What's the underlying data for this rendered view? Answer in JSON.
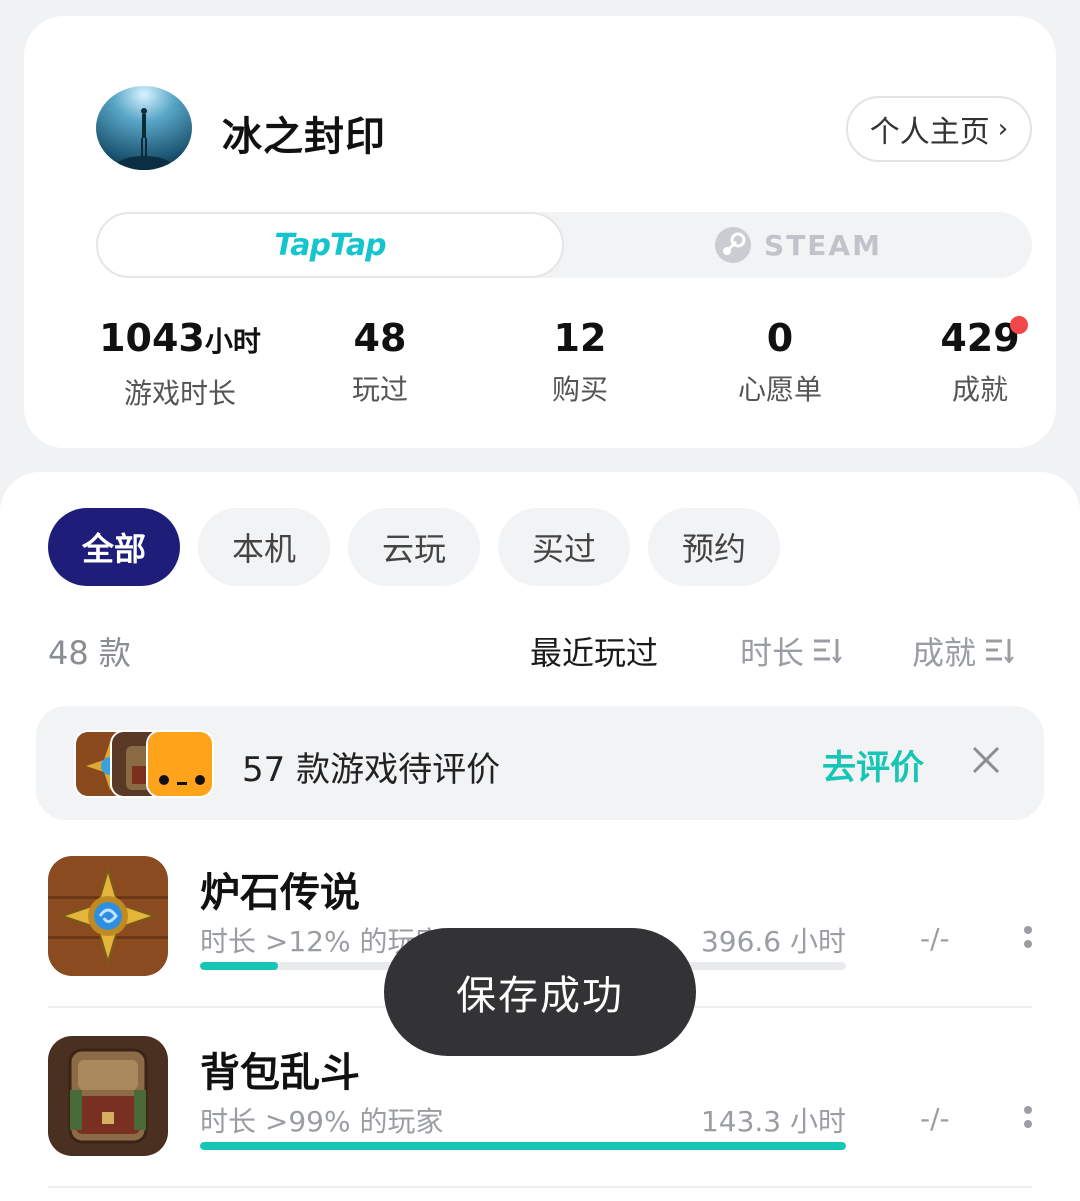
{
  "profile": {
    "username": "冰之封印",
    "homepage_label": "个人主页",
    "platform_tabs": {
      "taptap": "TapTap",
      "steam": "STEAM"
    },
    "stats": [
      {
        "value": "1043",
        "unit": "小时",
        "label": "游戏时长"
      },
      {
        "value": "48",
        "unit": "",
        "label": "玩过"
      },
      {
        "value": "12",
        "unit": "",
        "label": "购买"
      },
      {
        "value": "0",
        "unit": "",
        "label": "心愿单"
      },
      {
        "value": "429",
        "unit": "",
        "label": "成就",
        "badge": "red-dot"
      }
    ]
  },
  "filters": [
    "全部",
    "本机",
    "云玩",
    "买过",
    "预约"
  ],
  "active_filter": "全部",
  "list_header": {
    "count": "48 款",
    "sort_recent": "最近玩过",
    "sort_duration": "时长",
    "sort_achievement": "成就"
  },
  "review_banner": {
    "text": "57 款游戏待评价",
    "action": "去评价"
  },
  "games": [
    {
      "title": "炉石传说",
      "subtitle": "时长 >12% 的玩家",
      "hours": "396.6 小时",
      "progress": 0.12,
      "score": "-/-"
    },
    {
      "title": "背包乱斗",
      "subtitle": "时长 >99% 的玩家",
      "hours": "143.3 小时",
      "progress": 1.0,
      "score": "-/-"
    }
  ],
  "toast": "保存成功",
  "colors": {
    "accent_teal": "#15c5b5",
    "active_chip": "#1e1e7a",
    "badge_red": "#f04848"
  }
}
